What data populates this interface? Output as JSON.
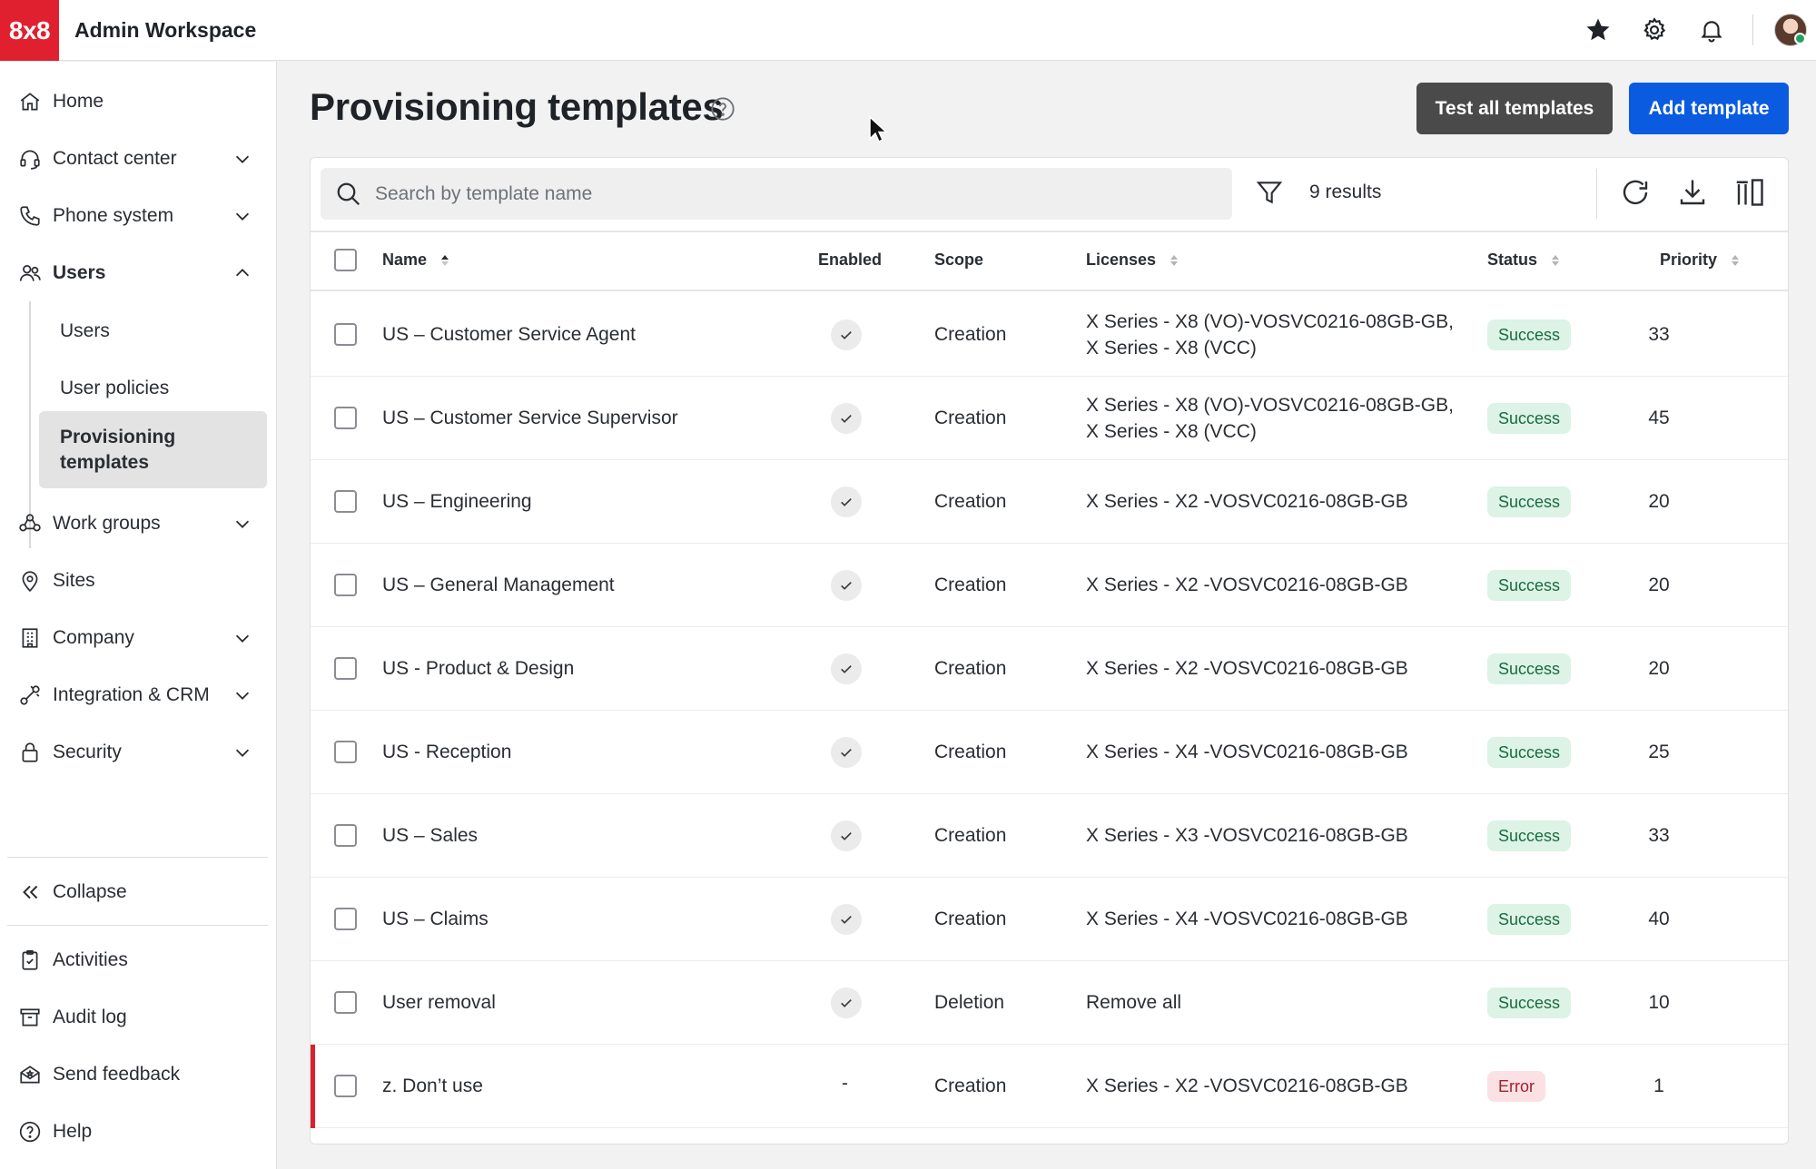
{
  "app": {
    "logo": "8x8",
    "title": "Admin Workspace"
  },
  "topbar": {
    "icons": [
      "star-icon",
      "gear-icon",
      "bell-icon"
    ]
  },
  "sidebar": {
    "items": [
      {
        "label": "Home",
        "icon": "home-icon"
      },
      {
        "label": "Contact center",
        "icon": "headset-icon"
      },
      {
        "label": "Phone system",
        "icon": "phone-icon"
      },
      {
        "label": "Users",
        "icon": "users-icon"
      },
      {
        "label": "Work groups",
        "icon": "work-groups-icon"
      },
      {
        "label": "Sites",
        "icon": "location-pin-icon"
      },
      {
        "label": "Company",
        "icon": "building-icon"
      },
      {
        "label": "Integration & CRM",
        "icon": "integration-icon"
      },
      {
        "label": "Security",
        "icon": "lock-icon"
      }
    ],
    "users_sub": [
      "Users",
      "User policies",
      "Provisioning templates"
    ],
    "collapse": "Collapse",
    "footer": [
      "Activities",
      "Audit log",
      "Send feedback",
      "Help"
    ]
  },
  "page": {
    "title": "Provisioning templates",
    "test_button": "Test all templates",
    "add_button": "Add template"
  },
  "toolbar": {
    "search_placeholder": "Search by template name",
    "results": "9 results"
  },
  "table": {
    "columns": {
      "name": "Name",
      "enabled": "Enabled",
      "scope": "Scope",
      "licenses": "Licenses",
      "status": "Status",
      "priority": "Priority"
    },
    "rows": [
      {
        "name": "US – Customer Service Agent",
        "enabled": true,
        "scope": "Creation",
        "licenses": [
          "X Series - X8 (VO)-VOSVC0216-08GB-GB,",
          "X Series - X8 (VCC)"
        ],
        "status": "Success",
        "priority": "33"
      },
      {
        "name": "US – Customer Service Supervisor",
        "enabled": true,
        "scope": "Creation",
        "licenses": [
          "X Series - X8 (VO)-VOSVC0216-08GB-GB,",
          "X Series - X8 (VCC)"
        ],
        "status": "Success",
        "priority": "45"
      },
      {
        "name": "US – Engineering",
        "enabled": true,
        "scope": "Creation",
        "licenses": [
          "X Series - X2 -VOSVC0216-08GB-GB"
        ],
        "status": "Success",
        "priority": "20"
      },
      {
        "name": "US – General Management",
        "enabled": true,
        "scope": "Creation",
        "licenses": [
          "X Series - X2 -VOSVC0216-08GB-GB"
        ],
        "status": "Success",
        "priority": "20"
      },
      {
        "name": "US - Product & Design",
        "enabled": true,
        "scope": "Creation",
        "licenses": [
          "X Series - X2 -VOSVC0216-08GB-GB"
        ],
        "status": "Success",
        "priority": "20"
      },
      {
        "name": "US - Reception",
        "enabled": true,
        "scope": "Creation",
        "licenses": [
          "X Series - X4 -VOSVC0216-08GB-GB"
        ],
        "status": "Success",
        "priority": "25"
      },
      {
        "name": "US – Sales",
        "enabled": true,
        "scope": "Creation",
        "licenses": [
          "X Series - X3 -VOSVC0216-08GB-GB"
        ],
        "status": "Success",
        "priority": "33"
      },
      {
        "name": "US – Claims",
        "enabled": true,
        "scope": "Creation",
        "licenses": [
          "X Series - X4 -VOSVC0216-08GB-GB"
        ],
        "status": "Success",
        "priority": "40"
      },
      {
        "name": "User removal",
        "enabled": true,
        "scope": "Deletion",
        "licenses": [
          "Remove all"
        ],
        "status": "Success",
        "priority": "10"
      },
      {
        "name": "z. Don’t use",
        "enabled": false,
        "enabled_text": "-",
        "scope": "Creation",
        "licenses": [
          "X Series - X2 -VOSVC0216-08GB-GB"
        ],
        "status": "Error",
        "priority": "1"
      }
    ]
  },
  "colors": {
    "brand": "#e0202e",
    "primary": "#0b5be0",
    "success_bg": "#dcf3e6",
    "error_bg": "#fbe1e3",
    "error_bar": "#d9202f"
  }
}
